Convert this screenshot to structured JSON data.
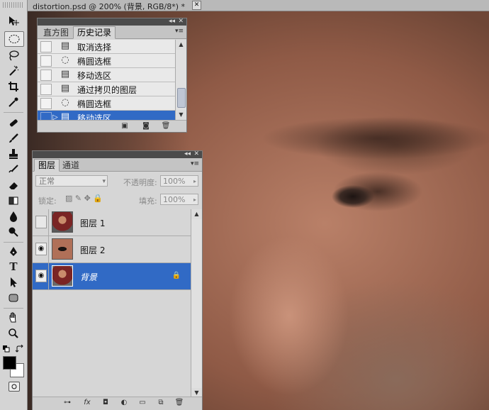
{
  "document": {
    "title": "distortion.psd @ 200% (背景, RGB/8*) *",
    "close": "✕"
  },
  "toolbar": {
    "tools": [
      "move-tool-icon",
      "elliptical-marquee-icon",
      "lasso-icon",
      "magic-wand-icon",
      "crop-icon",
      "eyedropper-icon",
      "healing-brush-icon",
      "brush-icon",
      "clone-stamp-icon",
      "history-brush-icon",
      "eraser-icon",
      "gradient-icon",
      "blur-icon",
      "dodge-icon",
      "pen-icon",
      "type-icon",
      "path-selection-icon",
      "rectangle-icon",
      "hand-icon",
      "zoom-icon"
    ],
    "type_glyph": "T"
  },
  "history": {
    "tabs": [
      "直方图",
      "历史记录"
    ],
    "active_tab": "历史记录",
    "items": [
      {
        "label": "取消选择",
        "icon": "history-state-icon"
      },
      {
        "label": "椭圆选框",
        "icon": "ellipse-marquee-icon"
      },
      {
        "label": "移动选区",
        "icon": "history-state-icon"
      },
      {
        "label": "通过拷贝的图层",
        "icon": "history-state-icon"
      },
      {
        "label": "椭圆选框",
        "icon": "ellipse-marquee-icon"
      },
      {
        "label": "移动选区",
        "icon": "history-state-icon",
        "selected": true
      }
    ]
  },
  "layers": {
    "tabs": [
      "图层",
      "通道"
    ],
    "active_tab": "图层",
    "blend_mode": "正常",
    "opacity_label": "不透明度:",
    "opacity_value": "100%",
    "lock_label": "锁定:",
    "fill_label": "填充:",
    "fill_value": "100%",
    "items": [
      {
        "name": "图层 1",
        "visible": false
      },
      {
        "name": "图层 2",
        "visible": true
      },
      {
        "name": "背景",
        "visible": true,
        "selected": true,
        "locked": true
      }
    ]
  },
  "colors": {
    "selection": "#316ac5",
    "panel": "#d6d6d6",
    "panel_header": "#4b4b4b"
  }
}
